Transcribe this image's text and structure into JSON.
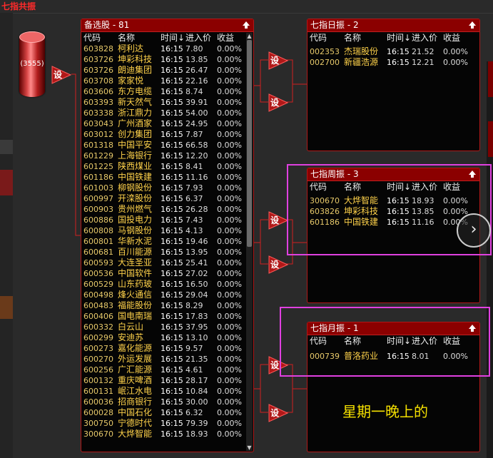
{
  "app": {
    "title": "七指共振"
  },
  "source": {
    "count": "(3555)"
  },
  "set_label": "设",
  "columns": {
    "code": "代码",
    "name": "名称",
    "time": "时间↓",
    "price": "进入价",
    "ret": "收益"
  },
  "panels": {
    "watchlist": {
      "title": "备选股 - 81",
      "rows": [
        [
          "603828",
          "柯利达",
          "16:15",
          "7.80",
          "0.00%"
        ],
        [
          "603726",
          "坤彩科技",
          "16:15",
          "13.85",
          "0.00%"
        ],
        [
          "603726",
          "朗迪集团",
          "16:15",
          "26.47",
          "0.00%"
        ],
        [
          "603708",
          "家家悦",
          "16:15",
          "22.16",
          "0.00%"
        ],
        [
          "603606",
          "东方电缆",
          "16:15",
          "8.74",
          "0.00%"
        ],
        [
          "603393",
          "新天然气",
          "16:15",
          "39.91",
          "0.00%"
        ],
        [
          "603338",
          "浙江鼎力",
          "16:15",
          "54.00",
          "0.00%"
        ],
        [
          "603043",
          "广州酒家",
          "16:15",
          "24.95",
          "0.00%"
        ],
        [
          "603012",
          "创力集团",
          "16:15",
          "7.87",
          "0.00%"
        ],
        [
          "601318",
          "中国平安",
          "16:15",
          "66.58",
          "0.00%"
        ],
        [
          "601229",
          "上海银行",
          "16:15",
          "12.20",
          "0.00%"
        ],
        [
          "601225",
          "陕西煤业",
          "16:15",
          "8.41",
          "0.00%"
        ],
        [
          "601186",
          "中国铁建",
          "16:15",
          "11.16",
          "0.00%"
        ],
        [
          "601003",
          "柳钢股份",
          "16:15",
          "7.93",
          "0.00%"
        ],
        [
          "600997",
          "开滦股份",
          "16:15",
          "6.37",
          "0.00%"
        ],
        [
          "600903",
          "贵州燃气",
          "16:15",
          "26.28",
          "0.00%"
        ],
        [
          "600886",
          "国投电力",
          "16:15",
          "7.43",
          "0.00%"
        ],
        [
          "600808",
          "马钢股份",
          "16:15",
          "4.13",
          "0.00%"
        ],
        [
          "600801",
          "华新水泥",
          "16:15",
          "19.46",
          "0.00%"
        ],
        [
          "600681",
          "百川能源",
          "16:15",
          "13.95",
          "0.00%"
        ],
        [
          "600593",
          "大连圣亚",
          "16:15",
          "25.41",
          "0.00%"
        ],
        [
          "600536",
          "中国软件",
          "16:15",
          "27.02",
          "0.00%"
        ],
        [
          "600529",
          "山东药玻",
          "16:15",
          "16.50",
          "0.00%"
        ],
        [
          "600498",
          "烽火通信",
          "16:15",
          "29.04",
          "0.00%"
        ],
        [
          "600483",
          "福能股份",
          "16:15",
          "8.29",
          "0.00%"
        ],
        [
          "600406",
          "国电南瑞",
          "16:15",
          "17.83",
          "0.00%"
        ],
        [
          "600332",
          "白云山",
          "16:15",
          "37.95",
          "0.00%"
        ],
        [
          "600299",
          "安迪苏",
          "16:15",
          "13.10",
          "0.00%"
        ],
        [
          "600273",
          "嘉化能源",
          "16:15",
          "9.57",
          "0.00%"
        ],
        [
          "600270",
          "外运发展",
          "16:15",
          "21.35",
          "0.00%"
        ],
        [
          "600256",
          "广汇能源",
          "16:15",
          "4.61",
          "0.00%"
        ],
        [
          "600132",
          "重庆啤酒",
          "16:15",
          "28.17",
          "0.00%"
        ],
        [
          "600131",
          "岷江水电",
          "16:15",
          "10.84",
          "0.00%"
        ],
        [
          "600036",
          "招商银行",
          "16:15",
          "30.00",
          "0.00%"
        ],
        [
          "600028",
          "中国石化",
          "16:15",
          "6.32",
          "0.00%"
        ],
        [
          "300750",
          "宁德时代",
          "16:15",
          "79.39",
          "0.00%"
        ],
        [
          "300670",
          "大烨智能",
          "16:15",
          "18.93",
          "0.00%"
        ]
      ]
    },
    "daily": {
      "title": "七指日振 - 2",
      "rows": [
        [
          "002353",
          "杰瑞股份",
          "16:15",
          "21.52",
          "0.00%"
        ],
        [
          "002700",
          "新疆浩源",
          "16:15",
          "12.21",
          "0.00%"
        ]
      ]
    },
    "weekly": {
      "title": "七指周振 - 3",
      "rows": [
        [
          "300670",
          "大烨智能",
          "16:15",
          "18.93",
          "0.00%"
        ],
        [
          "603826",
          "坤彩科技",
          "16:15",
          "13.85",
          "0.00%"
        ],
        [
          "601186",
          "中国铁建",
          "16:15",
          "11.16",
          "0.00%"
        ]
      ]
    },
    "monthly": {
      "title": "七指月振 - 1",
      "rows": [
        [
          "000739",
          "普洛药业",
          "16:15",
          "8.01",
          "0.00%"
        ]
      ]
    }
  },
  "note": "星期一晚上的",
  "colors": {
    "panel_header": "#8b0000",
    "code": "#e7c96a",
    "name": "#ffd24a",
    "highlight": "#e040e0",
    "note": "#f5e000"
  }
}
